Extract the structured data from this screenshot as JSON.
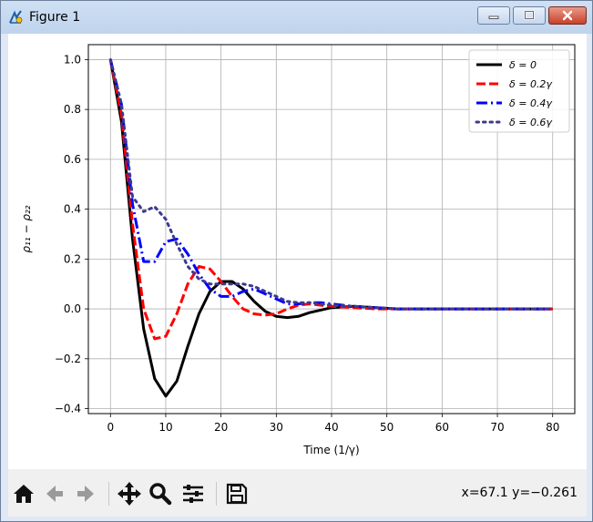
{
  "window": {
    "title": "Figure 1"
  },
  "toolbar": {
    "coords": "x=67.1 y=−0.261",
    "icons": [
      "home-icon",
      "back-arrow-icon",
      "forward-arrow-icon",
      "pan-icon",
      "zoom-icon",
      "configure-subplots-icon",
      "save-icon"
    ]
  },
  "chart_data": {
    "type": "line",
    "xlabel": "Time (1/γ)",
    "ylabel": "ρ₁₁ − ρ₂₂",
    "xlim": [
      -4,
      84
    ],
    "ylim": [
      -0.42,
      1.06
    ],
    "xticks": [
      0,
      10,
      20,
      30,
      40,
      50,
      60,
      70,
      80
    ],
    "yticks": [
      -0.4,
      -0.2,
      0.0,
      0.2,
      0.4,
      0.6,
      0.8,
      1.0
    ],
    "ytick_labels": [
      "−0.4",
      "−0.2",
      "0.0",
      "0.2",
      "0.4",
      "0.6",
      "0.8",
      "1.0"
    ],
    "grid": true,
    "legend_position": "top-right",
    "series": [
      {
        "name": "δ = 0",
        "color": "#000000",
        "dash": "solid",
        "x": [
          0,
          2,
          4,
          6,
          8,
          10,
          12,
          14,
          16,
          18,
          20,
          22,
          24,
          26,
          28,
          30,
          32,
          34,
          36,
          38,
          40,
          44,
          48,
          52,
          56,
          60,
          64,
          68,
          72,
          76,
          80
        ],
        "y": [
          1.0,
          0.75,
          0.28,
          -0.08,
          -0.28,
          -0.35,
          -0.29,
          -0.15,
          -0.02,
          0.07,
          0.11,
          0.11,
          0.08,
          0.03,
          -0.01,
          -0.03,
          -0.035,
          -0.03,
          -0.015,
          -0.005,
          0.005,
          0.01,
          0.005,
          0.0,
          0.0,
          0.0,
          0.0,
          0.0,
          0.0,
          0.0,
          0.0
        ]
      },
      {
        "name": "δ = 0.2γ",
        "color": "#ff0000",
        "dash": "dashed",
        "x": [
          0,
          2,
          4,
          6,
          8,
          10,
          12,
          14,
          16,
          18,
          20,
          22,
          24,
          26,
          28,
          30,
          32,
          34,
          36,
          38,
          40,
          44,
          48,
          52,
          56,
          60,
          64,
          68,
          72,
          76,
          80
        ],
        "y": [
          1.0,
          0.78,
          0.34,
          0.0,
          -0.12,
          -0.11,
          -0.02,
          0.1,
          0.17,
          0.16,
          0.11,
          0.05,
          0.0,
          -0.02,
          -0.025,
          -0.02,
          0.0,
          0.015,
          0.02,
          0.015,
          0.01,
          0.005,
          0.0,
          0.0,
          0.0,
          0.0,
          0.0,
          0.0,
          0.0,
          0.0,
          0.0
        ]
      },
      {
        "name": "δ = 0.4γ",
        "color": "#0000ff",
        "dash": "dashdot",
        "x": [
          0,
          2,
          4,
          6,
          8,
          10,
          12,
          14,
          16,
          18,
          20,
          22,
          24,
          26,
          28,
          30,
          32,
          34,
          36,
          38,
          40,
          44,
          48,
          52,
          56,
          60,
          64,
          68,
          72,
          76,
          80
        ],
        "y": [
          1.0,
          0.82,
          0.42,
          0.19,
          0.19,
          0.27,
          0.28,
          0.22,
          0.14,
          0.08,
          0.05,
          0.05,
          0.07,
          0.08,
          0.06,
          0.04,
          0.02,
          0.02,
          0.025,
          0.025,
          0.02,
          0.01,
          0.005,
          0.0,
          0.0,
          0.0,
          0.0,
          0.0,
          0.0,
          0.0,
          0.0
        ]
      },
      {
        "name": "δ = 0.6γ",
        "color": "#3b3b8e",
        "dash": "dotted",
        "x": [
          0,
          2,
          4,
          6,
          8,
          10,
          12,
          14,
          16,
          18,
          20,
          22,
          24,
          26,
          28,
          30,
          32,
          34,
          36,
          38,
          40,
          44,
          48,
          52,
          56,
          60,
          64,
          68,
          72,
          76,
          80
        ],
        "y": [
          1.0,
          0.82,
          0.45,
          0.39,
          0.41,
          0.36,
          0.26,
          0.17,
          0.12,
          0.1,
          0.1,
          0.1,
          0.1,
          0.09,
          0.07,
          0.05,
          0.03,
          0.025,
          0.025,
          0.02,
          0.015,
          0.01,
          0.005,
          0.0,
          0.0,
          0.0,
          0.0,
          0.0,
          0.0,
          0.0,
          0.0
        ]
      }
    ]
  }
}
